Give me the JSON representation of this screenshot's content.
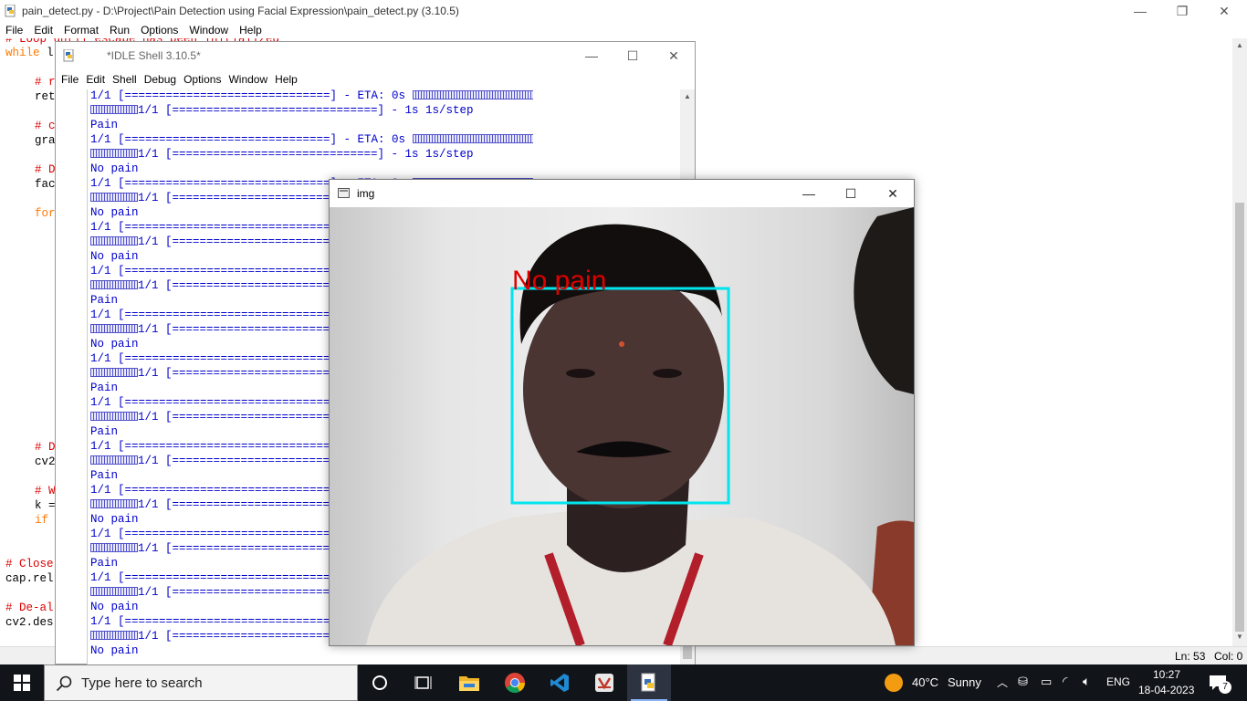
{
  "editor": {
    "title": "pain_detect.py - D:\\Project\\Pain Detection using Facial Expression\\pain_detect.py (3.10.5)",
    "menu": [
      "File",
      "Edit",
      "Format",
      "Run",
      "Options",
      "Window",
      "Help"
    ],
    "code": {
      "line_top_partial": "# Loop until escape has been initialized",
      "line_while_kw": "while",
      "line_while_rest": " l",
      "c1": "# r",
      "c1_code": "ret",
      "c2": "# c",
      "c2_code": "gra",
      "c3": "# D",
      "c3_code": "fac",
      "for_kw": "for",
      "c4": "# D",
      "c4_code": "cv2",
      "c5": "# W",
      "c5_code": "k =",
      "if_kw": "if",
      "c6": "# Close",
      "c6_code": "cap.rel",
      "c7": "# De-al",
      "c7_code": "cv2.des"
    },
    "status": {
      "ln": "Ln: 53",
      "col": "Col: 0"
    }
  },
  "shell": {
    "title": "*IDLE Shell 3.10.5*",
    "menu": [
      "File",
      "Edit",
      "Shell",
      "Debug",
      "Options",
      "Window",
      "Help"
    ],
    "eta_line": "1/1 [==============================] - ETA: 0s ",
    "step_line": "1/1 [==============================] - 1s 1s/step",
    "outputs": [
      "Pain",
      "No pain",
      "No pain",
      "No pain",
      "Pain",
      "No pain",
      "Pain",
      "Pain",
      "Pain",
      "No pain",
      "Pain",
      "No pain",
      "No pain"
    ]
  },
  "img_window": {
    "title": "img",
    "detection_label": "No pain",
    "box_color": "#00e5ee",
    "label_color": "#e00000"
  },
  "taskbar": {
    "search_placeholder": "Type here to search",
    "weather_temp": "40°C",
    "weather_desc": "Sunny",
    "language": "ENG",
    "time": "10:27",
    "date": "18-04-2023",
    "notification_count": "7",
    "apps": [
      "task-view",
      "file-explorer",
      "chrome",
      "vscode",
      "idle-app",
      "python-idle"
    ]
  }
}
